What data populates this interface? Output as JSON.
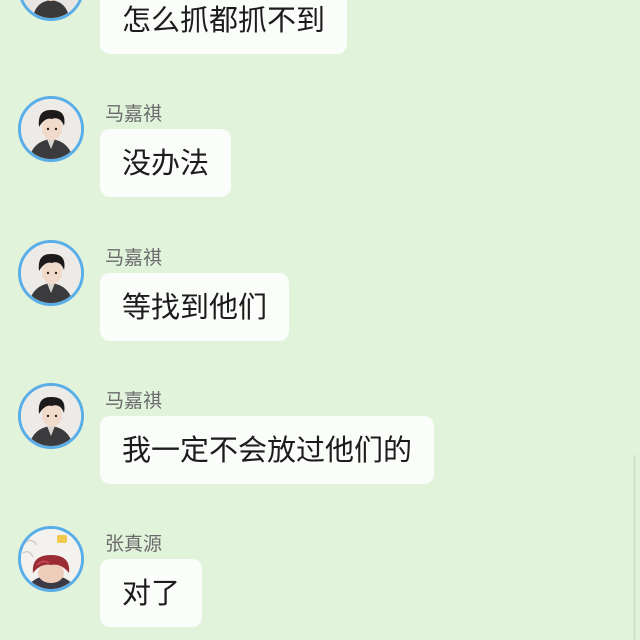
{
  "messages": [
    {
      "sender": "",
      "text": "怎么抓都抓不到",
      "avatar": "boy-avatar-icon"
    },
    {
      "sender": "马嘉祺",
      "text": "没办法",
      "avatar": "boy-avatar-icon"
    },
    {
      "sender": "马嘉祺",
      "text": "等找到他们",
      "avatar": "boy-avatar-icon"
    },
    {
      "sender": "马嘉祺",
      "text": "我一定不会放过他们的",
      "avatar": "boy-avatar-icon"
    },
    {
      "sender": "张真源",
      "text": "对了",
      "avatar": "red-hair-avatar-icon"
    }
  ],
  "colors": {
    "background": "#e2f3dc",
    "bubble": "#fafdf9",
    "avatar_border": "#5aaee8",
    "sender_name": "#6b6b6b"
  }
}
